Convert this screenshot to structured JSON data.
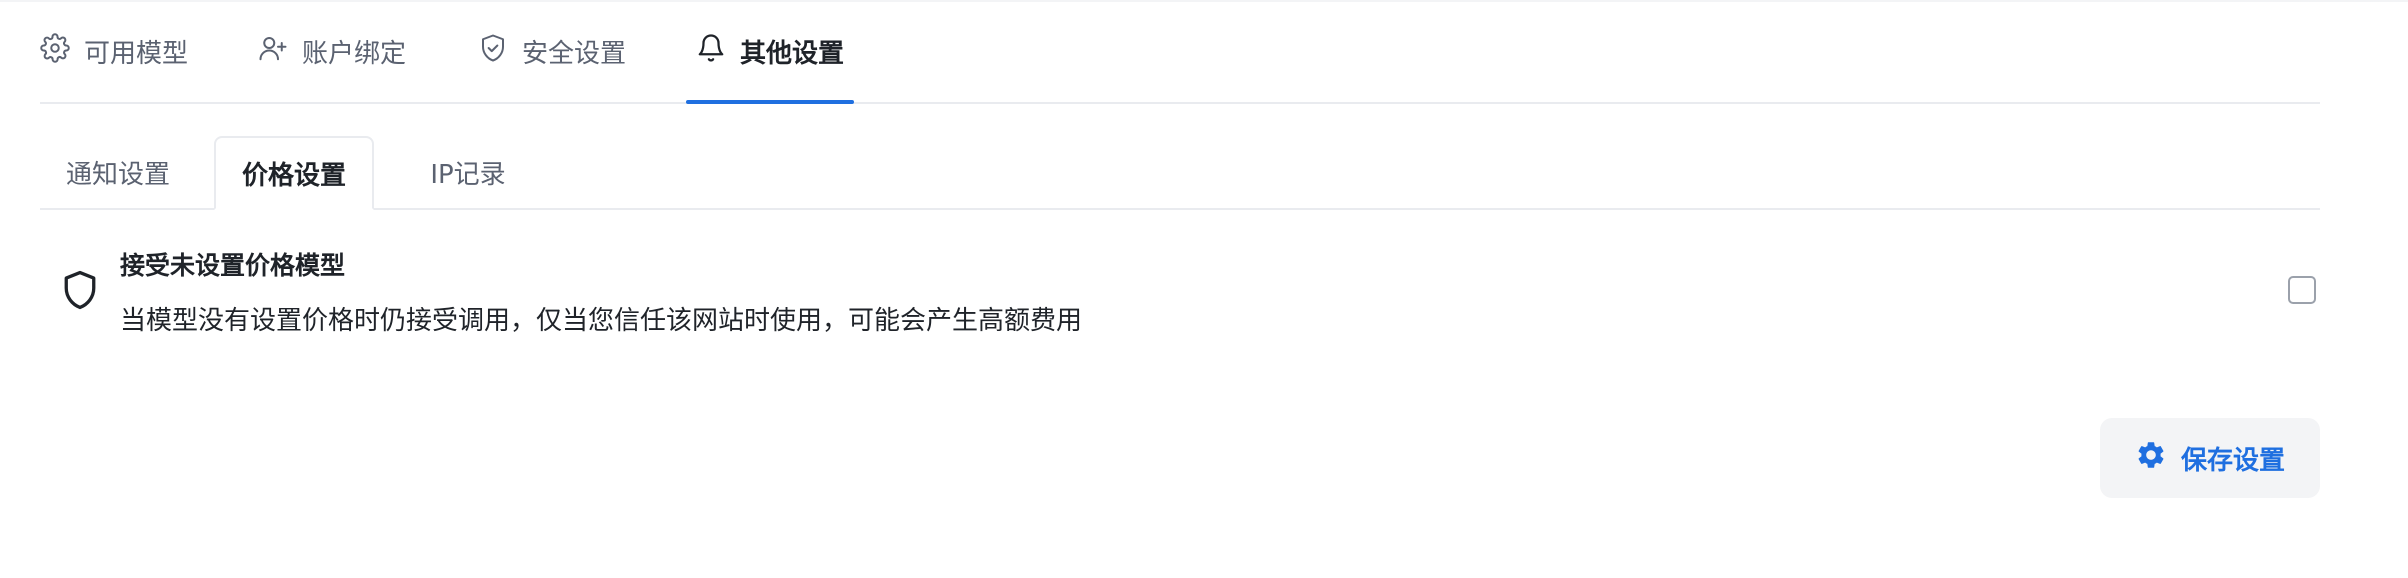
{
  "top_tabs": [
    {
      "label": "可用模型",
      "icon": "gear-icon",
      "active": false
    },
    {
      "label": "账户绑定",
      "icon": "user-plus-icon",
      "active": false
    },
    {
      "label": "安全设置",
      "icon": "shield-check-icon",
      "active": false
    },
    {
      "label": "其他设置",
      "icon": "bell-icon",
      "active": true
    }
  ],
  "sub_tabs": [
    {
      "label": "通知设置",
      "active": false
    },
    {
      "label": "价格设置",
      "active": true
    },
    {
      "label": "IP记录",
      "active": false
    }
  ],
  "setting": {
    "icon": "shield-icon",
    "title": "接受未设置价格模型",
    "description": "当模型没有设置价格时仍接受调用，仅当您信任该网站时使用，可能会产生高额费用",
    "checked": false
  },
  "save_button": {
    "icon": "gear-icon",
    "label": "保存设置"
  },
  "colors": {
    "accent": "#1f6fe0",
    "text": "#1f2329",
    "muted": "#5b6271",
    "border": "#e9ebef",
    "button_bg": "#f3f4f6"
  }
}
